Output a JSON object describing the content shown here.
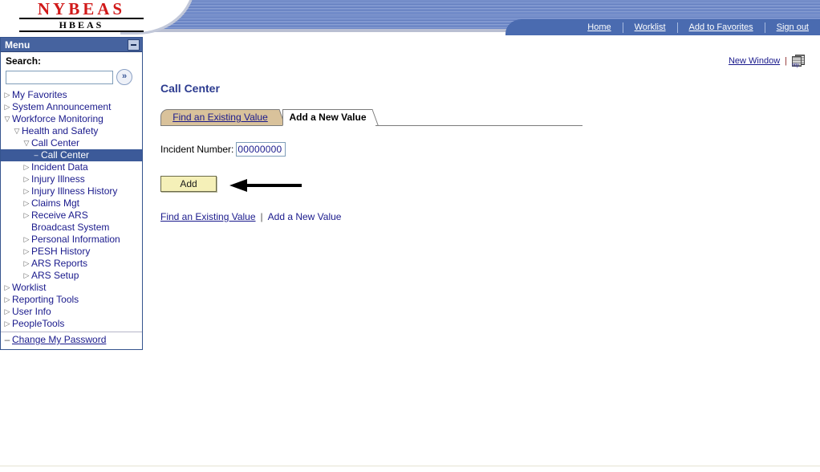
{
  "brand": {
    "logo_main": "NYBEAS",
    "logo_sub": "HBEAS"
  },
  "nav": {
    "items": [
      {
        "label": "Home"
      },
      {
        "label": "Worklist"
      },
      {
        "label": "Add to Favorites"
      },
      {
        "label": "Sign out"
      }
    ]
  },
  "menu": {
    "title": "Menu",
    "minimize_icon": "minimize-icon",
    "search_label": "Search:",
    "search_value": "",
    "search_placeholder": "",
    "search_button_icon": "double-chevron-right-icon",
    "tree": [
      {
        "label": "My Favorites",
        "level": 1,
        "state": "collapsed"
      },
      {
        "label": "System Announcement",
        "level": 1,
        "state": "collapsed"
      },
      {
        "label": "Workforce Monitoring",
        "level": 1,
        "state": "expanded"
      },
      {
        "label": "Health and Safety",
        "level": 2,
        "state": "expanded"
      },
      {
        "label": "Call Center",
        "level": 3,
        "state": "expanded"
      },
      {
        "label": "Call Center",
        "level": 4,
        "state": "leaf",
        "selected": true
      },
      {
        "label": "Incident Data",
        "level": 3,
        "state": "collapsed"
      },
      {
        "label": "Injury Illness",
        "level": 3,
        "state": "collapsed"
      },
      {
        "label": "Injury Illness History",
        "level": 3,
        "state": "collapsed"
      },
      {
        "label": "Claims Mgt",
        "level": 3,
        "state": "collapsed"
      },
      {
        "label": "Receive ARS Broadcast System",
        "level": 3,
        "state": "collapsed"
      },
      {
        "label": "Personal Information",
        "level": 3,
        "state": "collapsed"
      },
      {
        "label": "PESH History",
        "level": 3,
        "state": "collapsed"
      },
      {
        "label": "ARS Reports",
        "level": 3,
        "state": "collapsed"
      },
      {
        "label": "ARS Setup",
        "level": 3,
        "state": "collapsed"
      },
      {
        "label": "Worklist",
        "level": 1,
        "state": "collapsed"
      },
      {
        "label": "Reporting Tools",
        "level": 1,
        "state": "collapsed"
      },
      {
        "label": "User Info",
        "level": 1,
        "state": "collapsed"
      },
      {
        "label": "PeopleTools",
        "level": 1,
        "state": "collapsed"
      }
    ],
    "footer_link": "Change My Password"
  },
  "content": {
    "new_window_label": "New Window",
    "http_icon_label": "http",
    "page_title": "Call Center",
    "tabs": [
      {
        "label": "Find an Existing Value",
        "active": false
      },
      {
        "label": "Add a New Value",
        "active": true
      }
    ],
    "form": {
      "incident_label": "Incident Number:",
      "incident_value": "00000000"
    },
    "add_button_label": "Add",
    "bottom_links": {
      "find_existing": "Find an Existing Value",
      "separator": "|",
      "add_new": "Add a New Value"
    }
  },
  "colors": {
    "banner_blue": "#6b84c4",
    "navbar_blue": "#4a6bb0",
    "menu_header_blue": "#46639f",
    "selected_blue": "#3c5a99",
    "link_blue": "#1a1a8c",
    "title_blue": "#2c3b8f",
    "tab_inactive_tan": "#d9c29b",
    "button_yellow": "#f5f0b8",
    "logo_red": "#d11a1a"
  }
}
